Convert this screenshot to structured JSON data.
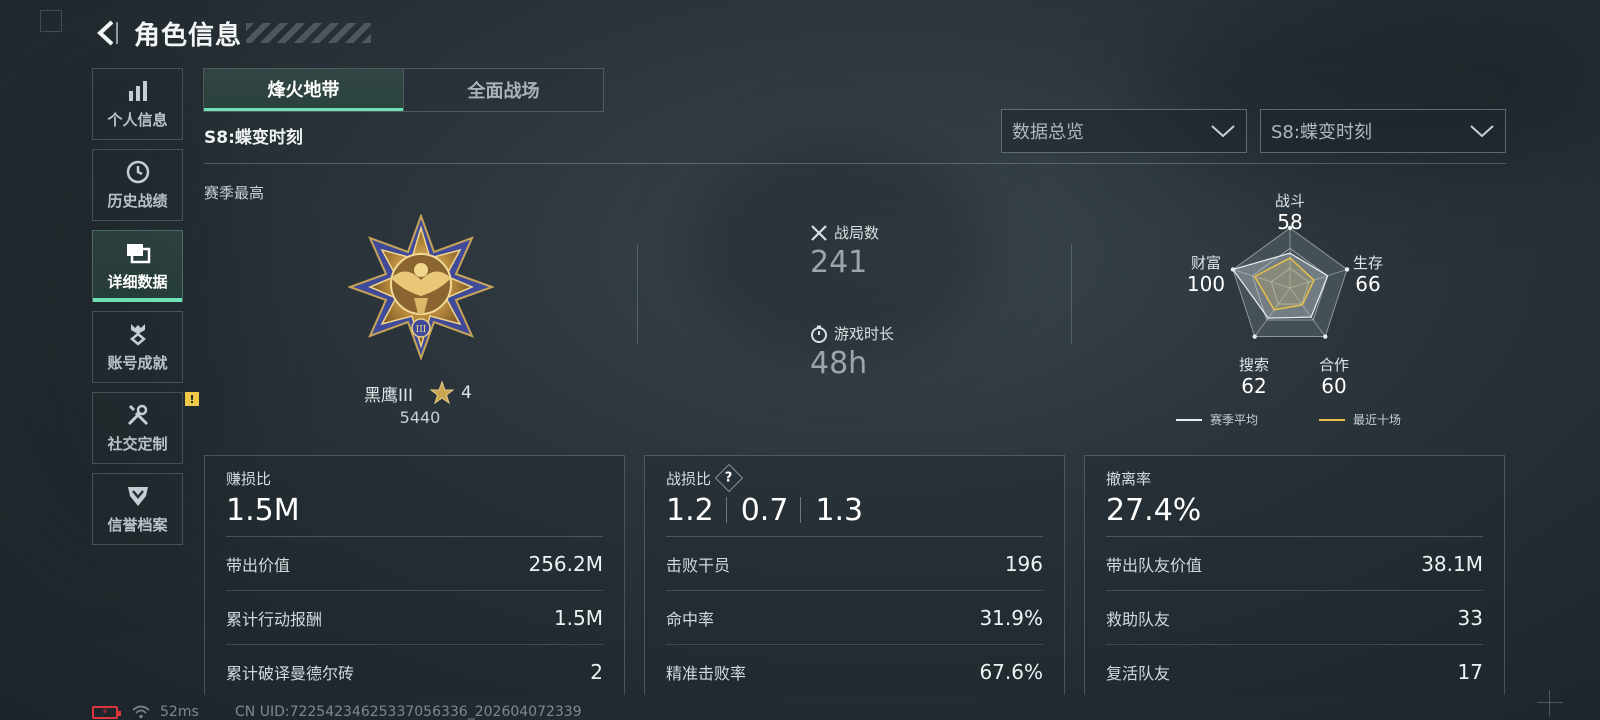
{
  "header": {
    "title": "角色信息"
  },
  "sidebar": {
    "items": [
      {
        "label": "个人信息",
        "icon": "bar-chart-icon",
        "active": false
      },
      {
        "label": "历史战绩",
        "icon": "clock-icon",
        "active": false
      },
      {
        "label": "详细数据",
        "icon": "cards-icon",
        "active": true
      },
      {
        "label": "账号成就",
        "icon": "achievement-icon",
        "active": false
      },
      {
        "label": "社交定制",
        "icon": "tools-icon",
        "active": false,
        "badge": "!"
      },
      {
        "label": "信誉档案",
        "icon": "shield-icon",
        "active": false
      }
    ]
  },
  "tabs": [
    {
      "label": "烽火地带",
      "active": true
    },
    {
      "label": "全面战场",
      "active": false
    }
  ],
  "season_title": "S8:蝶变时刻",
  "filters": {
    "overview": "数据总览",
    "season": "S8:蝶变时刻"
  },
  "best": {
    "label": "赛季最高",
    "rank_name": "黑鹰III",
    "stars": "4",
    "score": "5440"
  },
  "stats": {
    "matches_label": "战局数",
    "matches_value": "241",
    "playtime_label": "游戏时长",
    "playtime_value": "48h"
  },
  "radar": {
    "axes": [
      {
        "label": "战斗",
        "value": "58"
      },
      {
        "label": "生存",
        "value": "66"
      },
      {
        "label": "合作",
        "value": "60"
      },
      {
        "label": "搜索",
        "value": "62"
      },
      {
        "label": "财富",
        "value": "100"
      }
    ],
    "legend": [
      {
        "label": "赛季平均",
        "color": "#e8eef0"
      },
      {
        "label": "最近十场",
        "color": "#e8c04a"
      }
    ]
  },
  "cards": [
    {
      "title": "赚损比",
      "big": "1.5M",
      "rows": [
        {
          "k": "带出价值",
          "v": "256.2M"
        },
        {
          "k": "累计行动报酬",
          "v": "1.5M"
        },
        {
          "k": "累计破译曼德尔砖",
          "v": "2"
        }
      ]
    },
    {
      "title": "战损比",
      "help": "?",
      "big_parts": [
        "1.2",
        "0.7",
        "1.3"
      ],
      "rows": [
        {
          "k": "击败干员",
          "v": "196"
        },
        {
          "k": "命中率",
          "v": "31.9%"
        },
        {
          "k": "精准击败率",
          "v": "67.6%"
        }
      ]
    },
    {
      "title": "撤离率",
      "big": "27.4%",
      "rows": [
        {
          "k": "带出队友价值",
          "v": "38.1M"
        },
        {
          "k": "救助队友",
          "v": "33"
        },
        {
          "k": "复活队友",
          "v": "17"
        }
      ]
    }
  ],
  "status": {
    "ping": "52ms",
    "uid": "CN UID:72254234625337056336_202604072339"
  },
  "colors": {
    "accent": "#6fe0b6",
    "warning": "#f0c94a",
    "battery_low": "#d9363e"
  }
}
